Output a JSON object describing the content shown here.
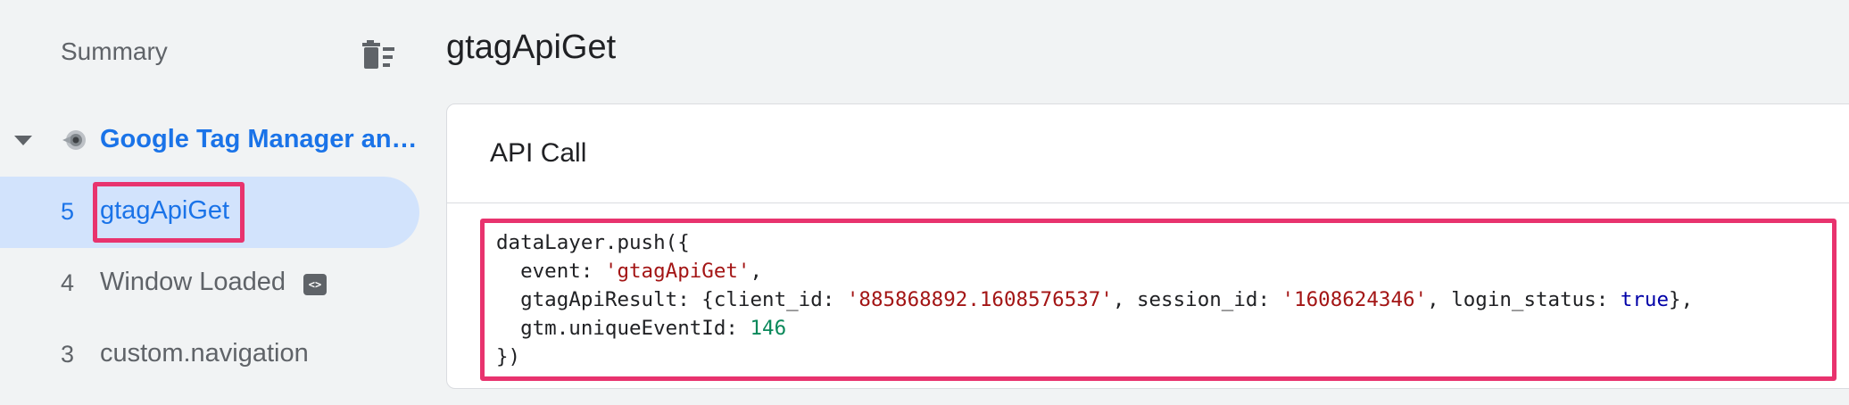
{
  "sidebar": {
    "summary_label": "Summary",
    "container": {
      "label": "Google Tag Manager an…",
      "icon": "container-icon"
    },
    "events": [
      {
        "number": "5",
        "label": "gtagApiGet",
        "selected": true
      },
      {
        "number": "4",
        "label": "Window Loaded",
        "badge": "<>"
      },
      {
        "number": "3",
        "label": "custom.navigation"
      }
    ]
  },
  "main": {
    "title": "gtagApiGet",
    "card": {
      "title": "API Call",
      "code": {
        "line1": "dataLayer.push({",
        "event_key": "event",
        "event_value": "'gtagApiGet'",
        "result_key": "gtagApiResult",
        "client_id_key": "client_id",
        "client_id_value": "'885868892.1608576537'",
        "session_id_key": "session_id",
        "session_id_value": "'1608624346'",
        "login_status_key": "login_status",
        "login_status_value": "true",
        "unique_id_key": "gtm.uniqueEventId",
        "unique_id_value": "146",
        "closing": "})"
      }
    }
  },
  "colors": {
    "accent": "#1a73e8",
    "selected_bg": "#d2e3fc",
    "highlight": "#e8336e",
    "string": "#a31515",
    "number": "#09885a",
    "keyword": "#0000a8"
  }
}
